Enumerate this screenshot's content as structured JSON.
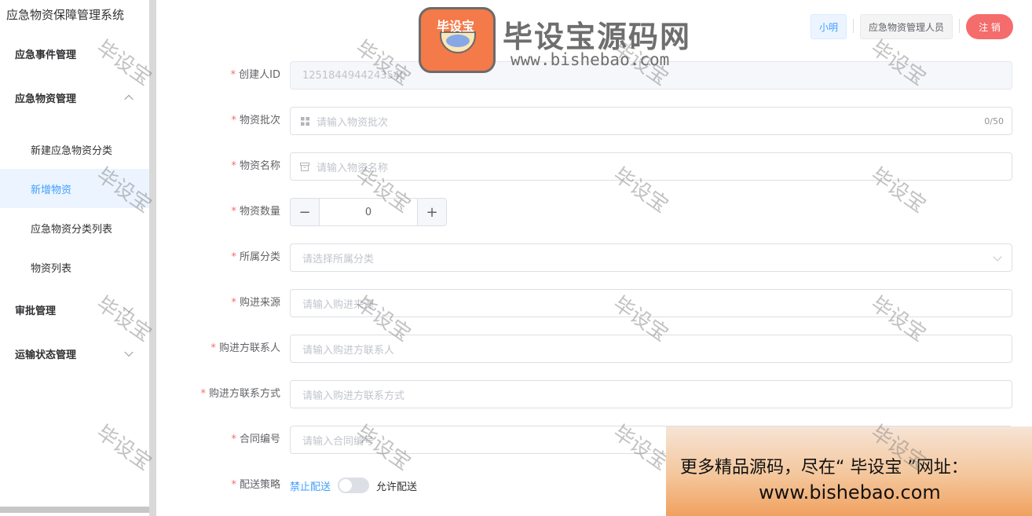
{
  "app_title": "应急物资保障管理系统",
  "sidebar": {
    "items": [
      {
        "label": "应急事件管理"
      },
      {
        "label": "应急物资管理"
      },
      {
        "label": "新建应急物资分类"
      },
      {
        "label": "新增物资"
      },
      {
        "label": "应急物资分类列表"
      },
      {
        "label": "物资列表"
      },
      {
        "label": "审批管理"
      },
      {
        "label": "运输状态管理"
      }
    ],
    "active_item": "新增物资"
  },
  "header": {
    "user_name": "小明",
    "role": "应急物资管理人员",
    "logout": "注 销"
  },
  "form": {
    "required_mark": "*",
    "creator_id": {
      "label": "创建人ID",
      "value": "1251844944243540"
    },
    "batch": {
      "label": "物资批次",
      "placeholder": "请输入物资批次",
      "counter": "0/50"
    },
    "name": {
      "label": "物资名称",
      "placeholder": "请输入物资名称"
    },
    "quantity": {
      "label": "物资数量",
      "value": "0",
      "minus": "−",
      "plus": "+"
    },
    "category": {
      "label": "所属分类",
      "placeholder": "请选择所属分类"
    },
    "source": {
      "label": "购进来源",
      "placeholder": "请输入购进来源"
    },
    "contact": {
      "label": "购进方联系人",
      "placeholder": "请输入购进方联系人"
    },
    "contact_method": {
      "label": "购进方联系方式",
      "placeholder": "请输入购进方联系方式"
    },
    "contract_no": {
      "label": "合同编号",
      "placeholder": "请输入合同编号"
    },
    "delivery": {
      "label": "配送策略",
      "off_label": "禁止配送",
      "on_label": "允许配送",
      "enabled": false
    }
  },
  "watermark": {
    "text": "毕设宝",
    "logo_badge": "毕设宝",
    "brand_name": "毕设宝源码网",
    "brand_url": "www.bishebao.com"
  },
  "ad": {
    "line1": "更多精品源码，尽在“ 毕设宝 ”网址：",
    "line2": "www.bishebao.com"
  },
  "colors": {
    "primary": "#409eff",
    "danger": "#f56c6c",
    "active_bg": "#ecf5ff"
  }
}
